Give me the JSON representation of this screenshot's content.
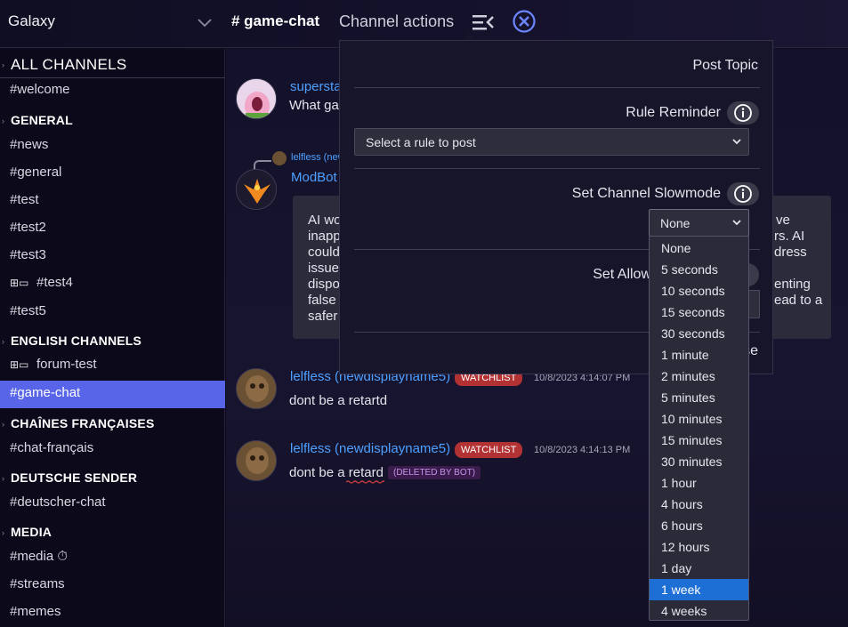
{
  "header": {
    "server_name": "Galaxy",
    "channel_title": "# game-chat",
    "channel_actions_label": "Channel actions"
  },
  "sidebar": {
    "all_channels": "ALL CHANNELS",
    "items": [
      {
        "type": "channel",
        "label": "#welcome"
      },
      {
        "type": "category",
        "label": "GENERAL"
      },
      {
        "type": "channel",
        "label": "#news"
      },
      {
        "type": "channel",
        "label": "#general"
      },
      {
        "type": "channel",
        "label": "#test"
      },
      {
        "type": "channel",
        "label": "#test2"
      },
      {
        "type": "channel",
        "label": "#test3"
      },
      {
        "type": "channel",
        "label": "#test4",
        "icon": "forum-icon"
      },
      {
        "type": "channel",
        "label": "#test5"
      },
      {
        "type": "category",
        "label": "ENGLISH CHANNELS"
      },
      {
        "type": "channel",
        "label": "forum-test",
        "icon": "forum-icon"
      },
      {
        "type": "channel",
        "label": "#game-chat",
        "active": true
      },
      {
        "type": "category",
        "label": "CHAÎNES FRANÇAISES"
      },
      {
        "type": "channel",
        "label": "#chat-français"
      },
      {
        "type": "category",
        "label": "DEUTSCHE SENDER"
      },
      {
        "type": "channel",
        "label": "#deutscher-chat"
      },
      {
        "type": "category",
        "label": "MEDIA"
      },
      {
        "type": "channel",
        "label": "#media ⏱"
      },
      {
        "type": "channel",
        "label": "#streams"
      },
      {
        "type": "channel",
        "label": "#memes"
      }
    ]
  },
  "messages": {
    "m1_user": "supersta",
    "m1_text": "What ga",
    "reply_user": "lelfless (newd",
    "m2_user": "ModBot",
    "embed_lines": [
      {
        "left": "AI wo",
        "right": "ve"
      },
      {
        "left": "inapp",
        "right": "rs. AI"
      },
      {
        "left": "could",
        "right": "dress"
      },
      {
        "left": "issue",
        "right": ""
      },
      {
        "left": "dispo",
        "right": "enting"
      },
      {
        "left": "false",
        "right": "ead to a"
      },
      {
        "left": "safer",
        "right": ""
      }
    ],
    "m3_user": "lelfless (newdisplayname5)",
    "m3_badge": "WATCHLIST",
    "m3_time": "10/8/2023 4:14:07 PM",
    "m3_text": "dont be a retartd",
    "m4_user": "lelfless (newdisplayname5)",
    "m4_badge": "WATCHLIST",
    "m4_time": "10/8/2023 4:14:13 PM",
    "m4_text_before": "dont be a ",
    "m4_text_flagged": "retard",
    "m4_deleted": "(DELETED BY BOT)"
  },
  "panel": {
    "post_topic": "Post Topic",
    "rule_reminder": "Rule Reminder",
    "rule_select_placeholder": "Select a rule to post",
    "slowmode_label": "Set Channel Slowmode",
    "slowmode_value": "None",
    "allow_label": "Set Allow",
    "bottom_fragment": "se"
  },
  "slowmode_options": [
    "None",
    "5 seconds",
    "10 seconds",
    "15 seconds",
    "30 seconds",
    "1 minute",
    "2 minutes",
    "5 minutes",
    "10 minutes",
    "15 minutes",
    "30 minutes",
    "1 hour",
    "4 hours",
    "6 hours",
    "12 hours",
    "1 day",
    "1 week",
    "4 weeks"
  ],
  "slowmode_highlighted": "1 week",
  "colors": {
    "accent": "#5865e8",
    "link": "#4da0ff",
    "watchlist": "#b23233",
    "highlight": "#1d6fd6"
  }
}
